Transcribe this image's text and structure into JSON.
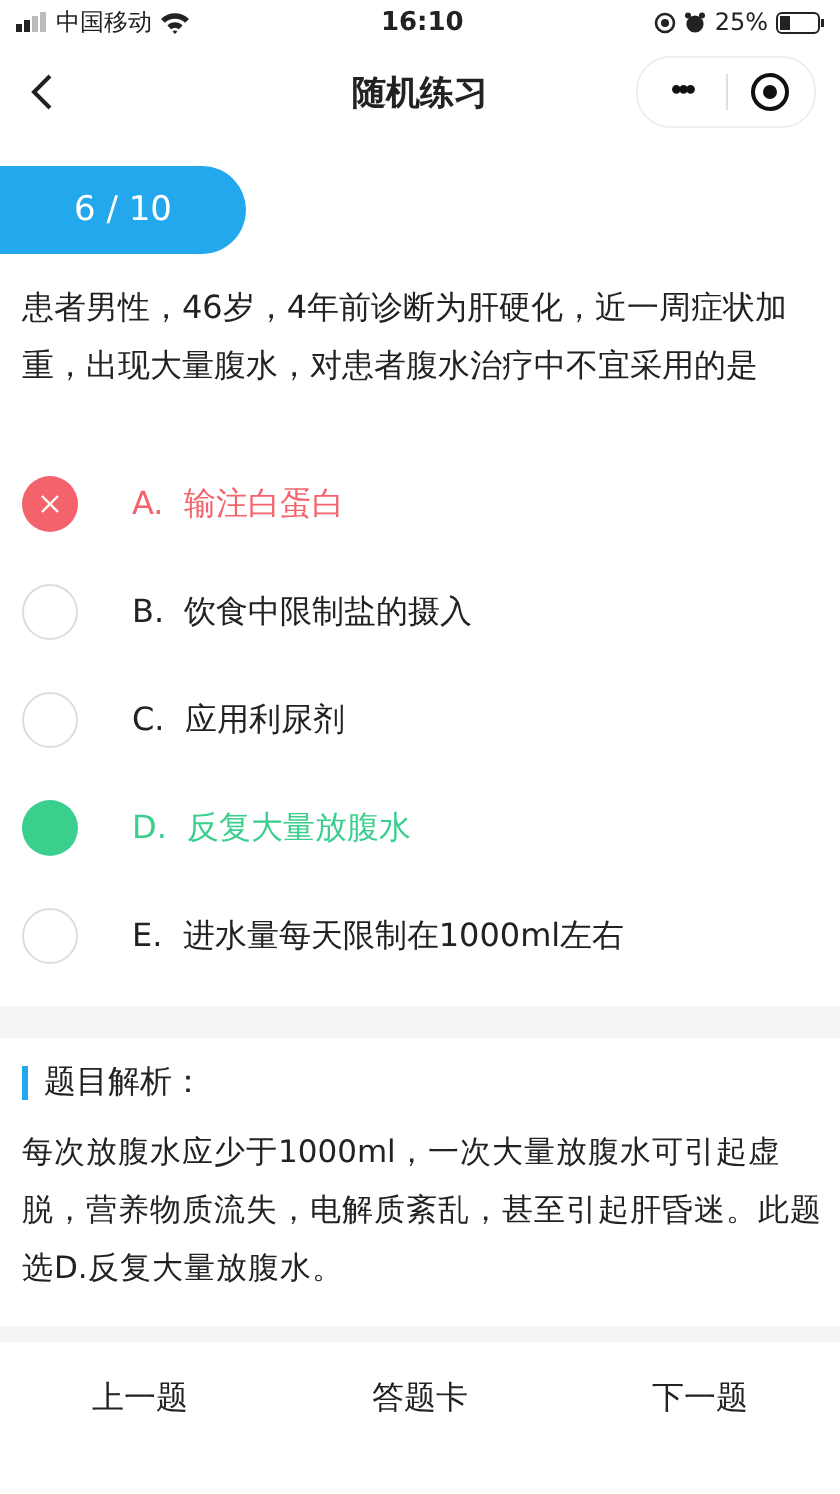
{
  "status_bar": {
    "carrier": "中国移动",
    "time": "16:10",
    "battery": "25%"
  },
  "nav": {
    "title": "随机练习",
    "more": "•••"
  },
  "progress": "6 / 10",
  "question": "患者男性，46岁，4年前诊断为肝硬化，近一周症状加重，出现大量腹水，对患者腹水治疗中不宜采用的是",
  "options": [
    {
      "letter": "A.",
      "text": "输注白蛋白",
      "kind": "wrong"
    },
    {
      "letter": "B.",
      "text": "饮食中限制盐的摄入",
      "kind": "plain"
    },
    {
      "letter": "C.",
      "text": "应用利尿剂",
      "kind": "plain"
    },
    {
      "letter": "D.",
      "text": "反复大量放腹水",
      "kind": "correct"
    },
    {
      "letter": "E.",
      "text": "进水量每天限制在1000ml左右",
      "kind": "plain"
    }
  ],
  "analysis": {
    "title": "题目解析：",
    "text": "每次放腹水应少于1000ml，一次大量放腹水可引起虚脱，营养物质流失，电解质紊乱，甚至引起肝昏迷。此题选D.反复大量放腹水。"
  },
  "bottom_bar": [
    "上一题",
    "答题卡",
    "下一题"
  ]
}
